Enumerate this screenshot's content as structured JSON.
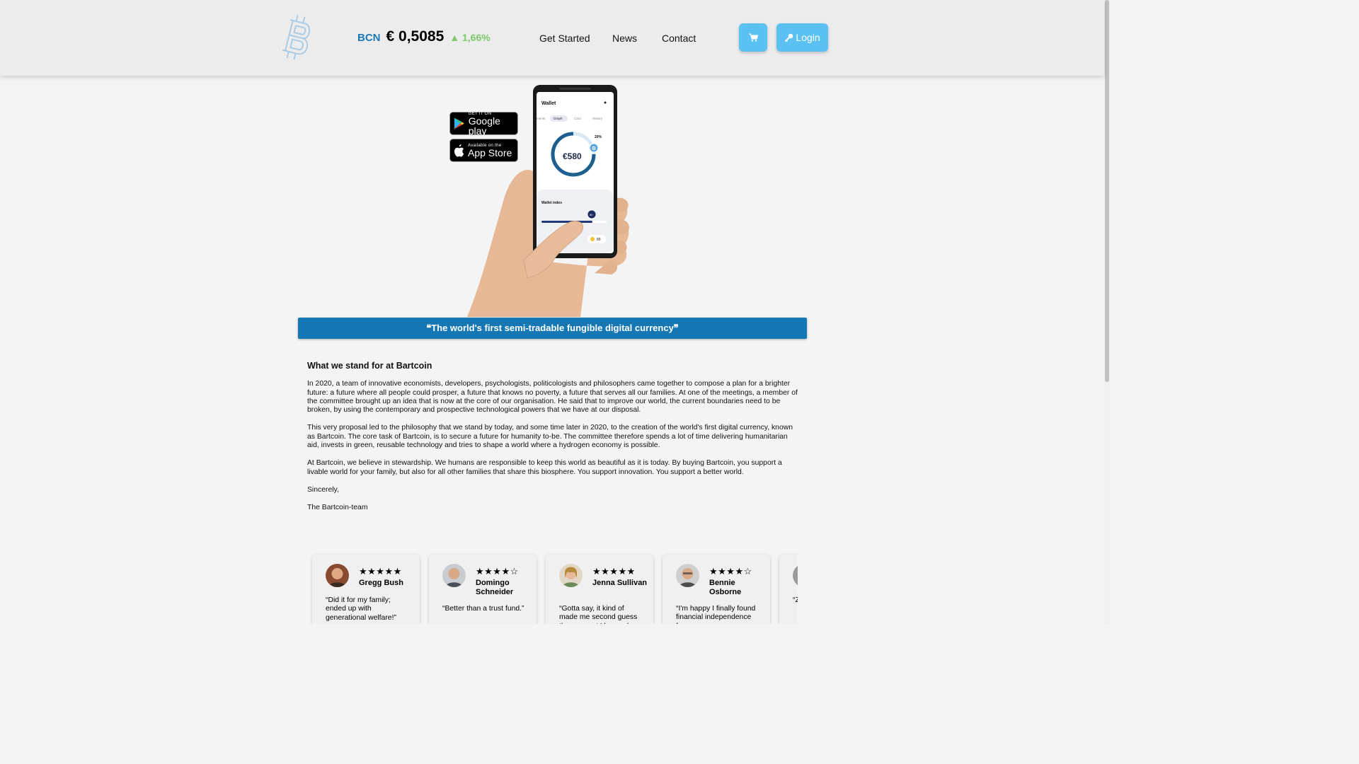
{
  "header": {
    "ticker": {
      "symbol": "BCN",
      "price": "€ 0,5085",
      "change": "▲ 1,66%"
    },
    "nav": [
      "Get Started",
      "News",
      "Contact"
    ],
    "login_label": "Login"
  },
  "hero": {
    "google_play": {
      "small": "GET IT ON",
      "big": "Google play"
    },
    "app_store": {
      "small": "Available on the",
      "big": "App Store"
    },
    "phone": {
      "title": "Wallet",
      "tabs": [
        "ments",
        "Graph",
        "Card",
        "History"
      ],
      "percent": "20%",
      "amount": "€580",
      "index_title": "Wallet index",
      "index_value": "80",
      "index_score": "89"
    }
  },
  "banner": "❝The world's first semi-tradable fungible digital currency❞",
  "article": {
    "heading": "What we stand for at Bartcoin",
    "paragraphs": [
      "In 2020, a team of innovative economists, developers, psychologists, politicologists and philosophers came together to compose a plan for a brighter future: a future where all people could prosper, a future that knows no poverty, a future that serves all our families. At one of the meetings, a member of the committee brought up an idea that is now at the core of our organisation. He said that to improve our world, the current boundaries need to be broken, by using the contemporary and prospective technological powers that we have at our disposal.",
      "This very proposal led to the philosophy that we stand by today, and some time later in 2020, to the creation of the world's first digital currency, known as Bartcoin. The core task of Bartcoin, is to secure a future for humanity to-be. The committee therefore spends a lot of time delivering humanitarian aid, invests in green, reusable technology and tries to shape a world where a hydrogen economy is possible.",
      "At Bartcoin, we believe in stewardship. We humans are responsible to keep this world as beautiful as it is today. By buying Bartcoin, you support a livable world for your family, but also for all other families that share this biosphere. You support innovation. You support a better world.",
      "Sincerely,",
      "The Bartcoin-team"
    ]
  },
  "reviews": [
    {
      "name": "Gregg Bush",
      "stars": "★★★★★",
      "rating": 5,
      "quote": "“Did it for my family; ended up with generational welfare!”"
    },
    {
      "name": "Domingo Schneider",
      "stars": "★★★★☆",
      "rating": 4,
      "quote": "“Better than a trust fund.”"
    },
    {
      "name": "Jenna Sullivan",
      "stars": "★★★★★",
      "rating": 5,
      "quote": "“Gotta say, it kind of made me second guess the moment I learned"
    },
    {
      "name": "Bennie Osborne",
      "stars": "★★★★☆",
      "rating": 4,
      "quote": "“I'm happy I finally found financial independence from my"
    },
    {
      "name": "",
      "stars": "",
      "rating": 0,
      "quote": "“Z"
    }
  ],
  "colors": {
    "accent": "#1577b4",
    "button": "#5bc0f2",
    "up": "#7cc86a"
  }
}
